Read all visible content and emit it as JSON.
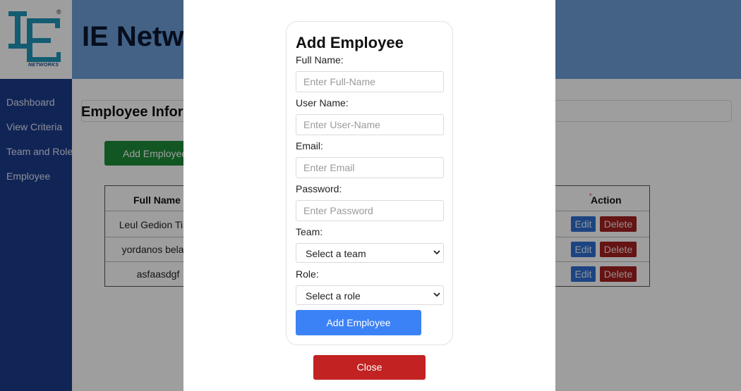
{
  "brand": {
    "registered": "®",
    "logo_sub": "NETWORKS",
    "header_title": "IE Netw"
  },
  "sidebar": {
    "items": [
      {
        "label": "Dashboard"
      },
      {
        "label": "View Criteria"
      },
      {
        "label": "Team and Role"
      },
      {
        "label": "Employee"
      }
    ]
  },
  "main": {
    "section_title": "Employee Inforr",
    "add_employee_button": "Add Employee",
    "table": {
      "headers": {
        "full_name": "Full Name",
        "action": "Action",
        "required_mark": "*"
      },
      "rows": [
        {
          "full_name": "Leul Gedion Tirun",
          "edit": "Edit",
          "delete": "Delete"
        },
        {
          "full_name": "yordanos belayn",
          "edit": "Edit",
          "delete": "Delete"
        },
        {
          "full_name": "asfaasdgf",
          "edit": "Edit",
          "delete": "Delete"
        }
      ]
    }
  },
  "modal": {
    "title": "Add Employee",
    "fields": {
      "full_name": {
        "label": "Full Name:",
        "placeholder": "Enter Full-Name"
      },
      "user_name": {
        "label": "User Name:",
        "placeholder": "Enter User-Name"
      },
      "email": {
        "label": "Email:",
        "placeholder": "Enter Email"
      },
      "password": {
        "label": "Password:",
        "placeholder": "Enter Password"
      },
      "team": {
        "label": "Team:",
        "selected": "Select a team"
      },
      "role": {
        "label": "Role:",
        "selected": "Select a role"
      }
    },
    "submit_label": "Add Employee",
    "close_label": "Close"
  },
  "colors": {
    "header_bg": "#6d9fd9",
    "sidebar_bg": "#1c3a8c",
    "submit_blue": "#3b82f6",
    "close_red": "#c22222",
    "add_green": "#1e8c3a",
    "edit_blue": "#2f6fd1",
    "delete_red": "#a31f1f"
  },
  "icons": {
    "logo": "ie-logo-icon",
    "select_arrow": "chevron-down-icon"
  }
}
